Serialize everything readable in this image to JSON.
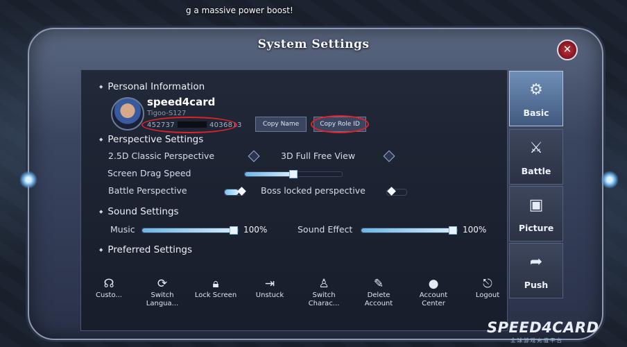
{
  "top_message": "g a massive power boost!",
  "window": {
    "title": "System Settings",
    "close_label": "✕"
  },
  "personal": {
    "header": "Personal Information",
    "username": "speed4card",
    "server": "Tigoo-S127",
    "role_id_start": "452737",
    "role_id_end": "4036813",
    "copy_name": "Copy Name",
    "copy_role_id": "Copy Role ID"
  },
  "perspective": {
    "header": "Perspective Settings",
    "option_25d": "2.5D Classic Perspective",
    "option_3d": "3D Full Free View",
    "drag_label": "Screen Drag Speed",
    "drag_level": 0.5,
    "battle_label": "Battle Perspective",
    "battle_on": true,
    "boss_label": "Boss locked perspective",
    "boss_on": false
  },
  "sound": {
    "header": "Sound Settings",
    "music_label": "Music",
    "music_value": "100%",
    "effect_label": "Sound Effect",
    "effect_value": "100%"
  },
  "preferred": {
    "header": "Preferred Settings"
  },
  "bottom_bar": [
    {
      "icon": "customer-service-icon",
      "label": "Custo..."
    },
    {
      "icon": "switch-language-icon",
      "label": "Switch Langua..."
    },
    {
      "icon": "lock-icon",
      "label": "Lock Screen"
    },
    {
      "icon": "unstuck-icon",
      "label": "Unstuck"
    },
    {
      "icon": "switch-character-icon",
      "label": "Switch Charac..."
    },
    {
      "icon": "delete-account-icon",
      "label": "Delete Account"
    },
    {
      "icon": "account-center-icon",
      "label": "Account Center"
    },
    {
      "icon": "logout-icon",
      "label": "Logout"
    }
  ],
  "tabs": [
    {
      "icon": "gear-icon",
      "label": "Basic",
      "active": true
    },
    {
      "icon": "battle-icon",
      "label": "Battle",
      "active": false
    },
    {
      "icon": "picture-icon",
      "label": "Picture",
      "active": false
    },
    {
      "icon": "push-icon",
      "label": "Push",
      "active": false
    }
  ],
  "watermark": {
    "brand": "SPEED4CARD",
    "sub": "全球游戏充值平台"
  }
}
